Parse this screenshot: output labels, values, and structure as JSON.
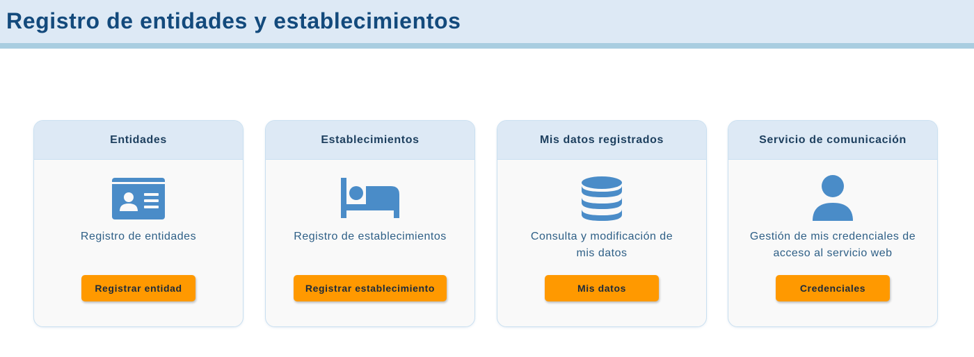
{
  "header": {
    "title": "Registro de entidades y establecimientos"
  },
  "colors": {
    "header_bg": "#dde9f5",
    "header_border": "#a9cde0",
    "title": "#134a7c",
    "icon": "#4a8cc8",
    "button": "#ff9900"
  },
  "cards": [
    {
      "title": "Entidades",
      "icon": "id-card-icon",
      "description": "Registro de entidades",
      "button": "Registrar entidad"
    },
    {
      "title": "Establecimientos",
      "icon": "bed-icon",
      "description": "Registro de establecimientos",
      "button": "Registrar establecimiento"
    },
    {
      "title": "Mis datos registrados",
      "icon": "database-icon",
      "description": "Consulta y modificación de mis datos",
      "button": "Mis datos"
    },
    {
      "title": "Servicio de comunicación",
      "icon": "user-icon",
      "description": "Gestión de mis credenciales de acceso al servicio web",
      "button": "Credenciales"
    }
  ]
}
